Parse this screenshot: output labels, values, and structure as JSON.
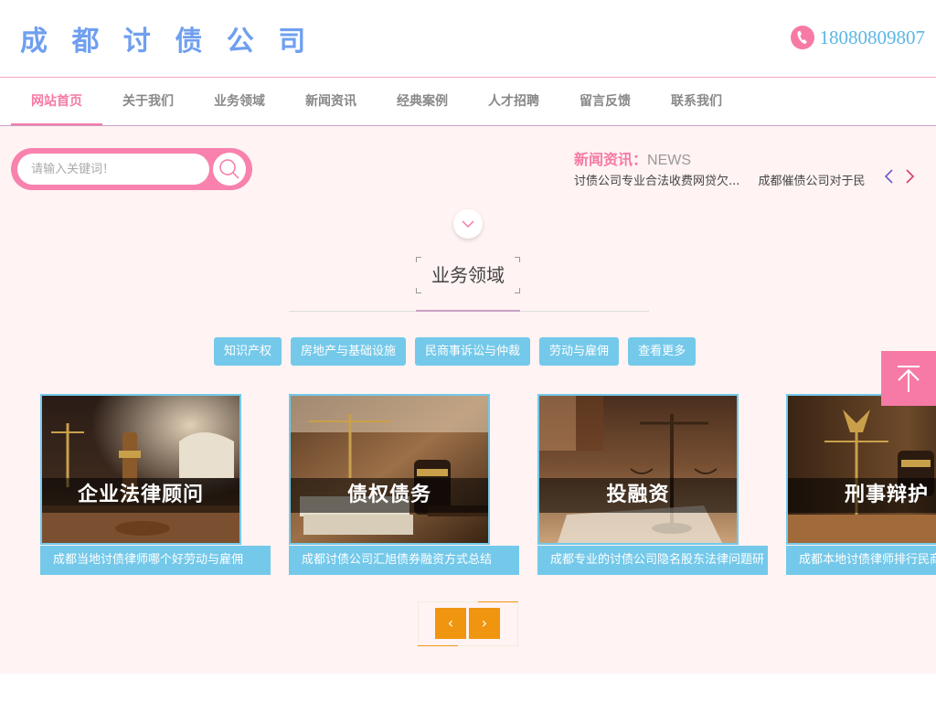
{
  "header": {
    "logo": "成 都 讨 债 公 司",
    "phone": "18080809807"
  },
  "nav": {
    "items": [
      "网站首页",
      "关于我们",
      "业务领域",
      "新闻资讯",
      "经典案例",
      "人才招聘",
      "留言反馈",
      "联系我们"
    ]
  },
  "search": {
    "placeholder": "请输入关键词！"
  },
  "news": {
    "title_cn": "新闻资讯",
    "title_sep": "：",
    "title_en": "NEWS",
    "items": [
      "讨债公司专业合法收费网贷欠...",
      "成都催债公司对于民"
    ]
  },
  "section": {
    "title": "业务领域"
  },
  "tags": [
    "知识产权",
    "房地产与基础设施",
    "民商事诉讼与仲裁",
    "劳动与雇佣",
    "查看更多"
  ],
  "cards": [
    {
      "label": "企业法律顾问",
      "caption": "成都当地讨债律师哪个好劳动与雇佣"
    },
    {
      "label": "债权债务",
      "caption": "成都讨债公司汇旭债券融资方式总结"
    },
    {
      "label": "投融资",
      "caption": "成都专业的讨债公司隐名股东法律问题研"
    },
    {
      "label": "刑事辩护",
      "caption": "成都本地讨债律师排行民商"
    }
  ],
  "pager": {
    "prev": "‹",
    "next": "›"
  },
  "colors": {
    "accent_pink": "#f67aa5",
    "accent_blue": "#74c9ea",
    "logo_blue": "#6f9ff0",
    "pager_orange": "#f0950f",
    "bg_pink": "#fff3f3"
  }
}
